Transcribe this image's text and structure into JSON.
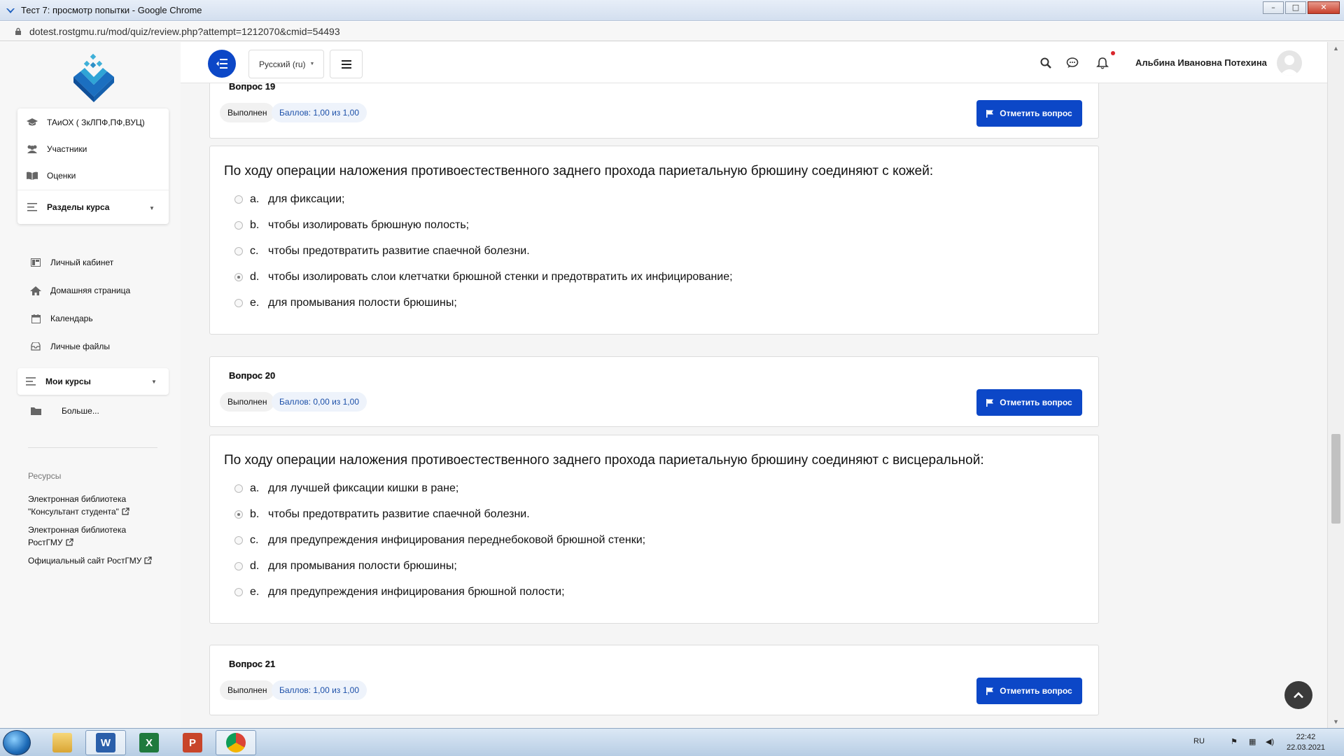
{
  "window": {
    "title": "Тест 7: просмотр попытки - Google Chrome",
    "url": "dotest.rostgmu.ru/mod/quiz/review.php?attempt=1212070&cmid=54493"
  },
  "sidebar": {
    "course_card": [
      {
        "label": "ТАиОХ ( ЗкЛПФ,ПФ,ВУЦ)",
        "icon": "graduation-cap-icon"
      },
      {
        "label": "Участники",
        "icon": "users-icon"
      },
      {
        "label": "Оценки",
        "icon": "book-icon"
      },
      {
        "label": "Разделы курса",
        "icon": "list-icon"
      }
    ],
    "nav": [
      {
        "label": "Личный кабинет",
        "icon": "dashboard-icon"
      },
      {
        "label": "Домашняя страница",
        "icon": "home-icon"
      },
      {
        "label": "Календарь",
        "icon": "calendar-icon"
      },
      {
        "label": "Личные файлы",
        "icon": "files-icon"
      }
    ],
    "my_courses": "Мои курсы",
    "more": "Больше...",
    "resources_heading": "Ресурсы",
    "resources": [
      {
        "line1": "Электронная библиотека",
        "line2": "\"Консультант студента\""
      },
      {
        "line1": "Электронная библиотека",
        "line2": "РостГМУ"
      },
      {
        "line1": "Официальный сайт РостГМУ",
        "line2": ""
      }
    ]
  },
  "navbar": {
    "language": "Русский (ru)",
    "user_name": "Альбина Ивановна Потехина"
  },
  "questions": [
    {
      "title": "Вопрос 19",
      "status": "Выполнен",
      "score": "Баллов: 1,00 из 1,00",
      "flag_label": "Отметить вопрос",
      "text": "По ходу операции наложения противоестественного заднего прохода париетальную брюшину соединяют с кожей:",
      "selected": 3,
      "answers": [
        {
          "letter": "a.",
          "text": "для фиксации;"
        },
        {
          "letter": "b.",
          "text": "чтобы изолировать брюшную полость;"
        },
        {
          "letter": "c.",
          "text": "чтобы предотвратить развитие спаечной болезни."
        },
        {
          "letter": "d.",
          "text": "чтобы изолировать слои клетчатки брюшной стенки и предотвратить их инфицирование;"
        },
        {
          "letter": "e.",
          "text": "для промывания полости брюшины;"
        }
      ]
    },
    {
      "title": "Вопрос 20",
      "status": "Выполнен",
      "score": "Баллов: 0,00 из 1,00",
      "flag_label": "Отметить вопрос",
      "text": "По ходу операции наложения противоестественного заднего прохода париетальную брюшину соединяют с висцеральной:",
      "selected": 1,
      "answers": [
        {
          "letter": "a.",
          "text": "для лучшей фиксации кишки в ране;"
        },
        {
          "letter": "b.",
          "text": "чтобы предотвратить развитие спаечной болезни."
        },
        {
          "letter": "c.",
          "text": "для предупреждения инфицирования переднебоковой брюшной стенки;"
        },
        {
          "letter": "d.",
          "text": "для промывания полости брюшины;"
        },
        {
          "letter": "e.",
          "text": "для предупреждения инфицирования брюшной полости;"
        }
      ]
    },
    {
      "title": "Вопрос 21",
      "status": "Выполнен",
      "score": "Баллов: 1,00 из 1,00",
      "flag_label": "Отметить вопрос"
    }
  ],
  "taskbar": {
    "apps": [
      "explorer-icon",
      "word-icon",
      "excel-icon",
      "powerpoint-icon",
      "chrome-icon"
    ],
    "lang": "RU",
    "time": "22:42",
    "date": "22.03.2021"
  },
  "colors": {
    "accent": "#0c47c7",
    "score_text": "#1b4fa8"
  }
}
